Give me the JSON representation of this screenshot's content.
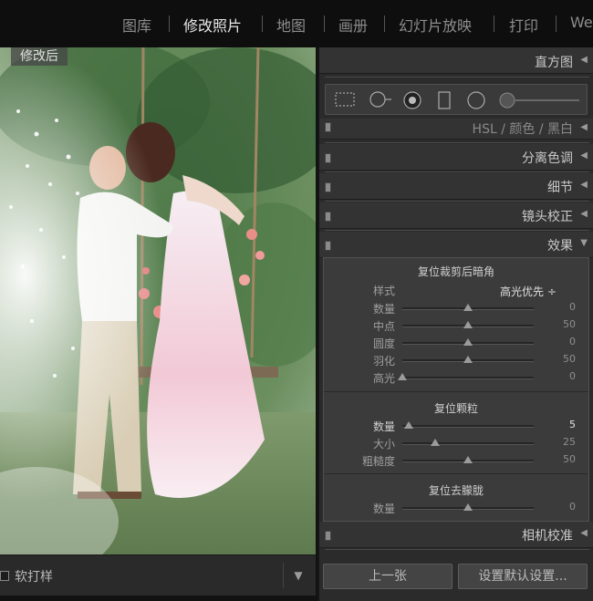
{
  "modules": {
    "items": [
      {
        "label": "图库"
      },
      {
        "label": "修改照片"
      },
      {
        "label": "地图"
      },
      {
        "label": "画册"
      },
      {
        "label": "幻灯片放映"
      },
      {
        "label": "打印"
      },
      {
        "label": "We"
      }
    ],
    "active_index": 1
  },
  "photo": {
    "after_label": "修改后"
  },
  "toolbar": {
    "soft_proof_label": "软打样",
    "soft_proof_checked": false
  },
  "panels": {
    "histogram": {
      "title": "直方图"
    },
    "hsl": {
      "title": "HSL / 颜色 / 黑白"
    },
    "split_toning": {
      "title": "分离色调"
    },
    "detail": {
      "title": "细节"
    },
    "lens": {
      "title": "镜头校正"
    },
    "effects": {
      "title": "效果"
    },
    "camera": {
      "title": "相机校准"
    }
  },
  "effects": {
    "vignette": {
      "title": "复位裁剪后暗角",
      "style_label": "样式",
      "style_value": "高光优先 ÷",
      "sliders": [
        {
          "label": "数量",
          "value": "0",
          "level": 0.5
        },
        {
          "label": "中点",
          "value": "50",
          "level": 0.5
        },
        {
          "label": "圆度",
          "value": "0",
          "level": 0.5
        },
        {
          "label": "羽化",
          "value": "50",
          "level": 0.5
        },
        {
          "label": "高光",
          "value": "0",
          "level": 0.0
        }
      ]
    },
    "grain": {
      "title": "复位颗粒",
      "sliders": [
        {
          "label": "数量",
          "value": "5",
          "level": 0.05
        },
        {
          "label": "大小",
          "value": "25",
          "level": 0.25
        },
        {
          "label": "粗糙度",
          "value": "50",
          "level": 0.5
        }
      ]
    },
    "dehaze": {
      "title": "复位去朦胧",
      "sliders": [
        {
          "label": "数量",
          "value": "0",
          "level": 0.5
        }
      ]
    }
  },
  "buttons": {
    "previous": "上一张",
    "set_default": "设置默认设置..."
  },
  "colors": {
    "panel_bg": "#2b2b2b",
    "active_module": "#e6e6e6",
    "inactive_module": "#8d8d8d"
  }
}
